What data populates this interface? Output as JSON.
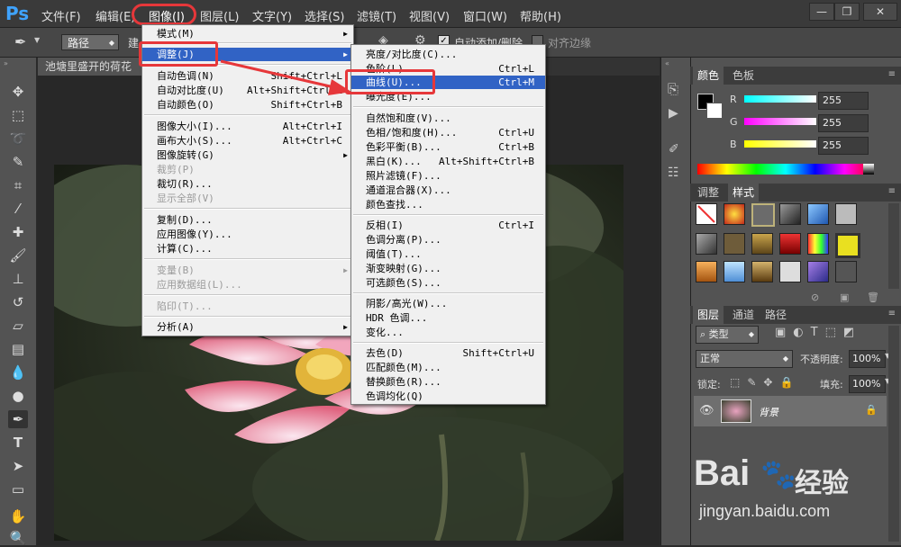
{
  "app": {
    "logo": "Ps"
  },
  "menubar": {
    "items": [
      "文件(F)",
      "编辑(E)",
      "图像(I)",
      "图层(L)",
      "文字(Y)",
      "选择(S)",
      "滤镜(T)",
      "视图(V)",
      "窗口(W)",
      "帮助(H)"
    ],
    "window_buttons": [
      "—",
      "❐",
      "✕"
    ]
  },
  "options_bar": {
    "path_mode": "路径",
    "auto_add_delete_label": "自动添加/删除",
    "align_edges_label": "对齐边缘"
  },
  "document": {
    "tab_title": "池塘里盛开的荷花"
  },
  "image_menu": {
    "items": [
      {
        "label": "模式(M)",
        "submenu": true
      },
      {
        "label": "调整(J)",
        "submenu": true,
        "highlighted": true
      },
      {
        "label": "自动色调(N)",
        "shortcut": "Shift+Ctrl+L"
      },
      {
        "label": "自动对比度(U)",
        "shortcut": "Alt+Shift+Ctrl+L"
      },
      {
        "label": "自动颜色(O)",
        "shortcut": "Shift+Ctrl+B"
      },
      {
        "label": "图像大小(I)...",
        "shortcut": "Alt+Ctrl+I"
      },
      {
        "label": "画布大小(S)...",
        "shortcut": "Alt+Ctrl+C"
      },
      {
        "label": "图像旋转(G)",
        "submenu": true
      },
      {
        "label": "裁剪(P)",
        "disabled": true
      },
      {
        "label": "裁切(R)..."
      },
      {
        "label": "显示全部(V)",
        "disabled": true
      },
      {
        "label": "复制(D)..."
      },
      {
        "label": "应用图像(Y)..."
      },
      {
        "label": "计算(C)..."
      },
      {
        "label": "变量(B)",
        "submenu": true,
        "disabled": true
      },
      {
        "label": "应用数据组(L)...",
        "disabled": true
      },
      {
        "label": "陷印(T)...",
        "disabled": true
      },
      {
        "label": "分析(A)",
        "submenu": true
      }
    ]
  },
  "adjust_menu": {
    "items": [
      {
        "label": "亮度/对比度(C)..."
      },
      {
        "label": "色阶(L)...",
        "shortcut": "Ctrl+L"
      },
      {
        "label": "曲线(U)...",
        "shortcut": "Ctrl+M",
        "highlighted": true
      },
      {
        "label": "曝光度(E)..."
      },
      {
        "label": "自然饱和度(V)..."
      },
      {
        "label": "色相/饱和度(H)...",
        "shortcut": "Ctrl+U"
      },
      {
        "label": "色彩平衡(B)...",
        "shortcut": "Ctrl+B"
      },
      {
        "label": "黑白(K)...",
        "shortcut": "Alt+Shift+Ctrl+B"
      },
      {
        "label": "照片滤镜(F)..."
      },
      {
        "label": "通道混合器(X)..."
      },
      {
        "label": "颜色查找..."
      },
      {
        "label": "反相(I)",
        "shortcut": "Ctrl+I"
      },
      {
        "label": "色调分离(P)..."
      },
      {
        "label": "阈值(T)..."
      },
      {
        "label": "渐变映射(G)..."
      },
      {
        "label": "可选颜色(S)..."
      },
      {
        "label": "阴影/高光(W)..."
      },
      {
        "label": "HDR 色调..."
      },
      {
        "label": "变化..."
      },
      {
        "label": "去色(D)",
        "shortcut": "Shift+Ctrl+U"
      },
      {
        "label": "匹配颜色(M)..."
      },
      {
        "label": "替换颜色(R)..."
      },
      {
        "label": "色调均化(Q)"
      }
    ]
  },
  "color_panel": {
    "tabs": [
      "颜色",
      "色板"
    ],
    "channels": [
      {
        "name": "R",
        "value": "255"
      },
      {
        "name": "G",
        "value": "255"
      },
      {
        "name": "B",
        "value": "255"
      }
    ]
  },
  "styles_panel": {
    "tabs": [
      "调整",
      "样式"
    ]
  },
  "layers_panel": {
    "tabs": [
      "图层",
      "通道",
      "路径"
    ],
    "kind_filter": "类型",
    "blend_mode": "正常",
    "opacity_label": "不透明度:",
    "opacity_value": "100%",
    "lock_label": "锁定:",
    "fill_label": "填充:",
    "fill_value": "100%",
    "layer_name": "背景"
  },
  "watermark": {
    "brand": "Bai",
    "brand2": "经验",
    "url": "jingyan.baidu.com"
  },
  "colors": {
    "highlight": "#3163c5",
    "annotation": "#e6373a",
    "ps_blue": "#3fa3ff"
  }
}
